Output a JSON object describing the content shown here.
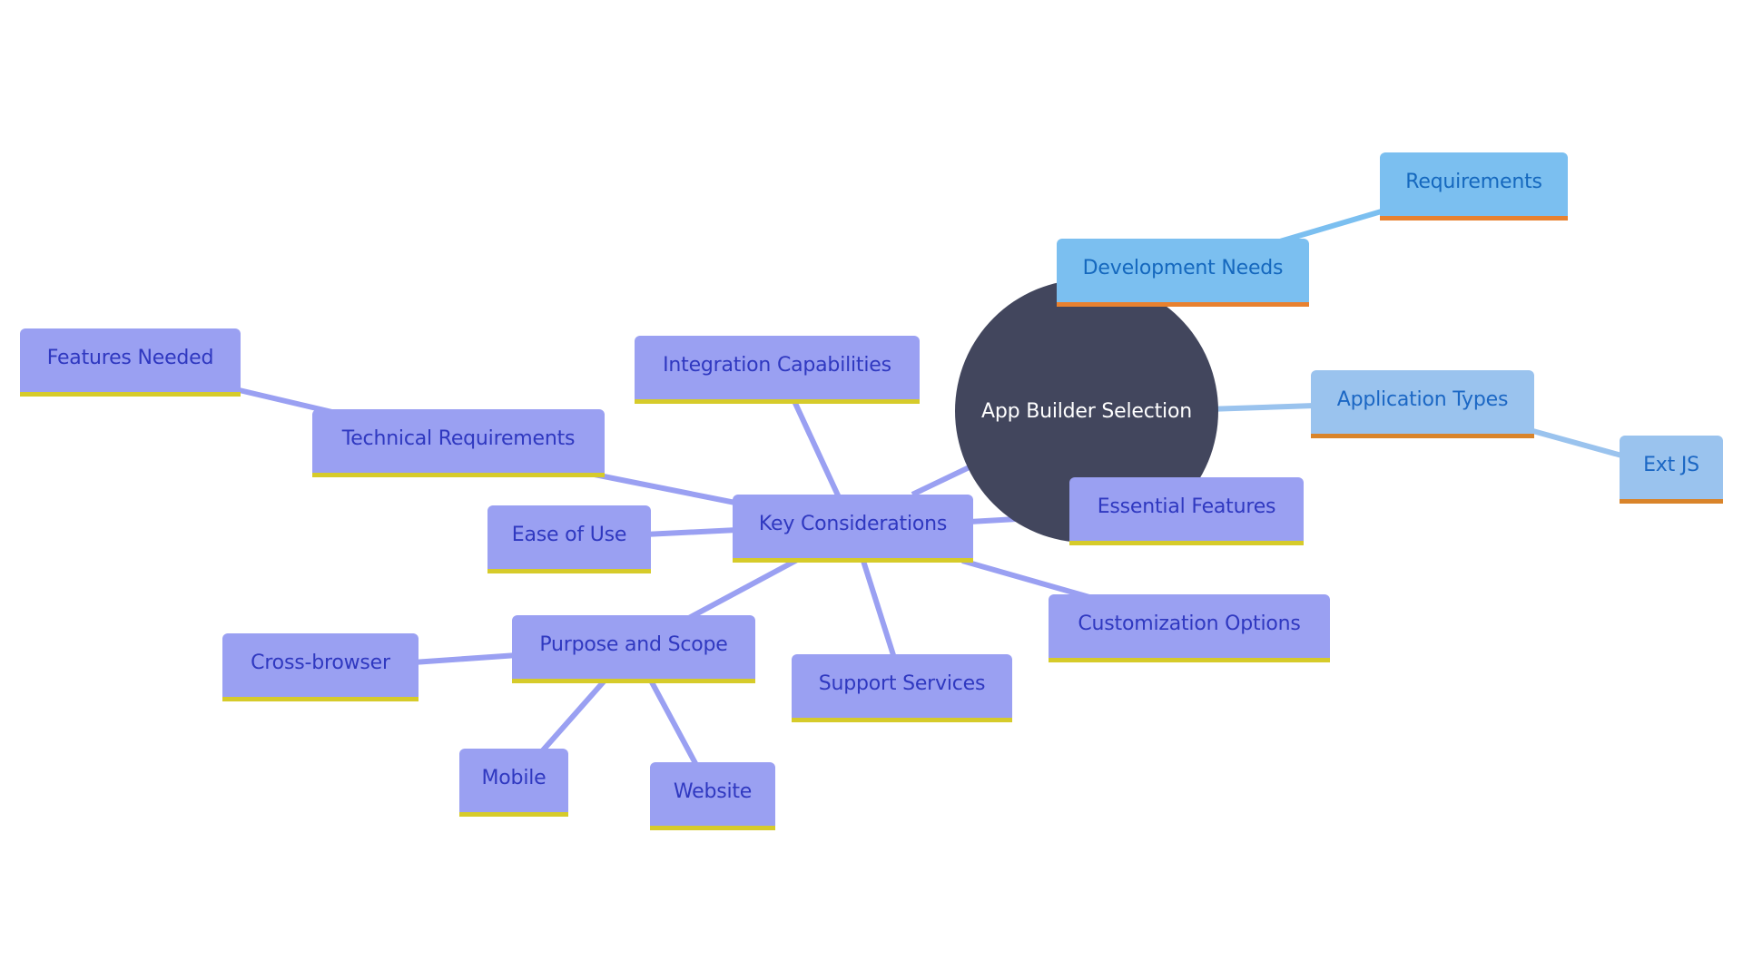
{
  "diagram": {
    "type": "mindmap",
    "root": {
      "id": "root",
      "label": "App Builder Selection"
    },
    "colors": {
      "root_fill": "#42465d",
      "root_text": "#ffffff",
      "purple_fill": "#9aa0f2",
      "purple_text": "#2f38c0",
      "purple_accent": "#d6cb2a",
      "purple_edge": "#9aa0f2",
      "blue_fill": "#7bbff0",
      "blue_text": "#1568be",
      "blue_accent": "#e8812f",
      "blue_edge": "#7bbff0",
      "light_blue_fill": "#9ac3ee",
      "light_blue_text": "#1b67c4",
      "light_blue_accent": "#d9842a",
      "light_blue_edge": "#9ac3ee"
    },
    "nodes": {
      "key_considerations": {
        "label": "Key Considerations",
        "parent": "root"
      },
      "technical_requirements": {
        "label": "Technical Requirements",
        "parent": "key_considerations"
      },
      "features_needed": {
        "label": "Features Needed",
        "parent": "technical_requirements"
      },
      "integration_capabilities": {
        "label": "Integration Capabilities",
        "parent": "key_considerations"
      },
      "ease_of_use": {
        "label": "Ease of Use",
        "parent": "key_considerations"
      },
      "essential_features": {
        "label": "Essential Features",
        "parent": "key_considerations"
      },
      "customization_options": {
        "label": "Customization Options",
        "parent": "key_considerations"
      },
      "support_services": {
        "label": "Support Services",
        "parent": "key_considerations"
      },
      "purpose_and_scope": {
        "label": "Purpose and Scope",
        "parent": "key_considerations"
      },
      "cross_browser": {
        "label": "Cross-browser",
        "parent": "purpose_and_scope"
      },
      "mobile": {
        "label": "Mobile",
        "parent": "purpose_and_scope"
      },
      "website": {
        "label": "Website",
        "parent": "purpose_and_scope"
      },
      "development_needs": {
        "label": "Development Needs",
        "parent": "root"
      },
      "requirements": {
        "label": "Requirements",
        "parent": "development_needs"
      },
      "application_types": {
        "label": "Application Types",
        "parent": "root"
      },
      "ext_js": {
        "label": "Ext JS",
        "parent": "application_types"
      }
    }
  }
}
